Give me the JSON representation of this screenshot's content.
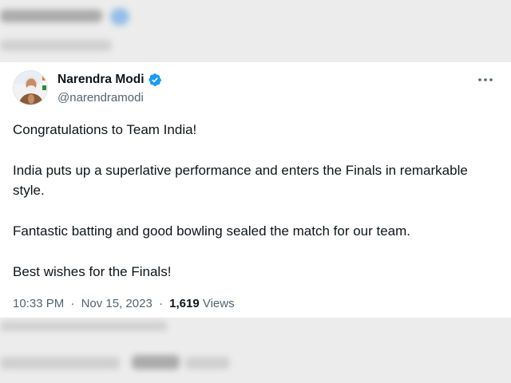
{
  "tweet": {
    "author": {
      "display_name": "Narendra Modi",
      "handle": "@narendramodi",
      "verified": true,
      "verified_color": "#1d9bf0"
    },
    "paragraphs": [
      "Congratulations to Team India!",
      "India puts up a superlative performance and enters the Finals in remarkable style.",
      "Fantastic batting and good bowling sealed the match for our team.",
      "Best wishes for the Finals!"
    ],
    "time": "10:33 PM",
    "date": "Nov 15, 2023",
    "separator": "·",
    "views_count": "1,619",
    "views_label": "Views"
  },
  "icons": {
    "more": "more-horizontal-icon",
    "verified": "verified-badge-icon"
  }
}
